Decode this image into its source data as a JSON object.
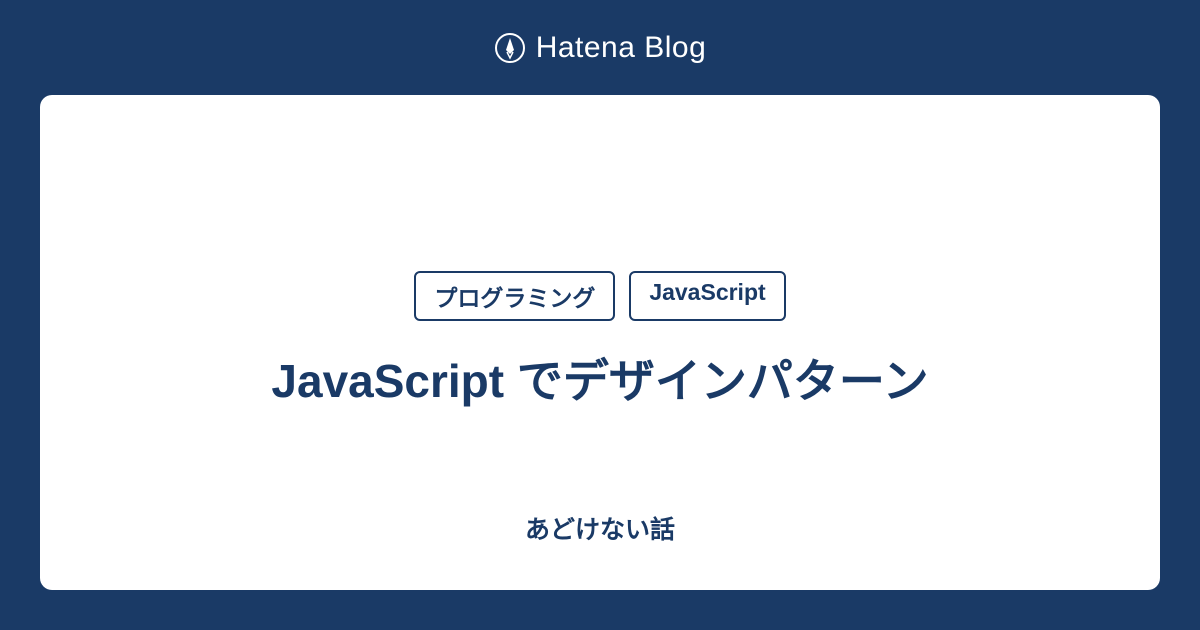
{
  "header": {
    "brand": "Hatena Blog"
  },
  "card": {
    "tags": [
      "プログラミング",
      "JavaScript"
    ],
    "title": "JavaScript でデザインパターン",
    "subtitle": "あどけない話"
  },
  "colors": {
    "background": "#1a3a66",
    "card_background": "#ffffff",
    "text_primary": "#1a3a66"
  }
}
